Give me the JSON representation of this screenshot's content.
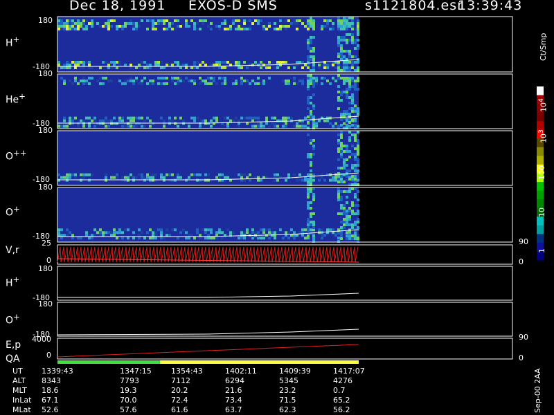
{
  "header": {
    "date": "Dec 18, 1991",
    "instrument": "EXOS-D SMS",
    "file": "s1121804.esr",
    "time": "13:39:43"
  },
  "panels": [
    {
      "label": "H",
      "sup": "+",
      "top": "180",
      "bottom": "-180"
    },
    {
      "label": "He",
      "sup": "+",
      "top": "180",
      "bottom": "-180"
    },
    {
      "label": "O",
      "sup": "++",
      "top": "180",
      "bottom": "-180"
    },
    {
      "label": "O",
      "sup": "+",
      "top": "180",
      "bottom": "-180"
    },
    {
      "label": "V,r",
      "sup": "",
      "top": "25",
      "bottom": "0",
      "right_top": "90",
      "right_bottom": "0"
    },
    {
      "label": "H",
      "sup": "+",
      "top": "180",
      "bottom": "-180"
    },
    {
      "label": "O",
      "sup": "+",
      "top": "180",
      "bottom": "-180"
    },
    {
      "label": "E,p",
      "sup": "",
      "top": "4000",
      "bottom": "0",
      "right_top": "90",
      "right_bottom": "0"
    }
  ],
  "qa_label": "QA",
  "colorbar": {
    "unit": "Ct/Smp",
    "ticks": [
      {
        "base": "10",
        "exp": "4"
      },
      {
        "base": "10",
        "exp": "3"
      },
      {
        "base": "100",
        "exp": ""
      },
      {
        "base": "10",
        "exp": ""
      },
      {
        "base": "1",
        "exp": ""
      }
    ],
    "colors": [
      "#ffffff",
      "#a00000",
      "#8a0000",
      "#7a0000",
      "#b00000",
      "#ff0000",
      "#5a4a00",
      "#8a8a00",
      "#b0b000",
      "#ffff00",
      "#b0ff00",
      "#00c000",
      "#00a000",
      "#008800",
      "#006c00",
      "#00c0c0",
      "#00a0a0",
      "#003080",
      "#1010a0",
      "#000080"
    ]
  },
  "footer_label": "Sep-00 2AA",
  "footer": {
    "rows": [
      {
        "name": "UT",
        "values": [
          "1339:43",
          "1347:15",
          "1354:43",
          "1402:11",
          "1409:39",
          "1417:07"
        ]
      },
      {
        "name": "ALT",
        "values": [
          "8343",
          "7793",
          "7112",
          "6294",
          "5345",
          "4276"
        ]
      },
      {
        "name": "MLT",
        "values": [
          "18.6",
          "19.3",
          "20.2",
          "21.6",
          "23.2",
          "0.7"
        ]
      },
      {
        "name": "InLat",
        "values": [
          "67.1",
          "70.0",
          "72.4",
          "73.4",
          "71.5",
          "65.2"
        ]
      },
      {
        "name": "MLat",
        "values": [
          "52.6",
          "57.6",
          "61.6",
          "63.7",
          "62.3",
          "56.2"
        ]
      }
    ]
  },
  "chart_data": {
    "type": "heatmap",
    "series": [
      {
        "name": "H+"
      },
      {
        "name": "He+"
      },
      {
        "name": "O++"
      },
      {
        "name": "O+"
      }
    ],
    "x_ticks": [
      "1339:43",
      "1347:15",
      "1354:43",
      "1402:11",
      "1409:39",
      "1417:07"
    ],
    "ylim": [
      -180,
      180
    ],
    "qa_segments": [
      {
        "color": "#40e040",
        "from": 0,
        "to": 0.34
      },
      {
        "color": "#ffff40",
        "from": 0.34,
        "to": 1.0
      }
    ]
  }
}
